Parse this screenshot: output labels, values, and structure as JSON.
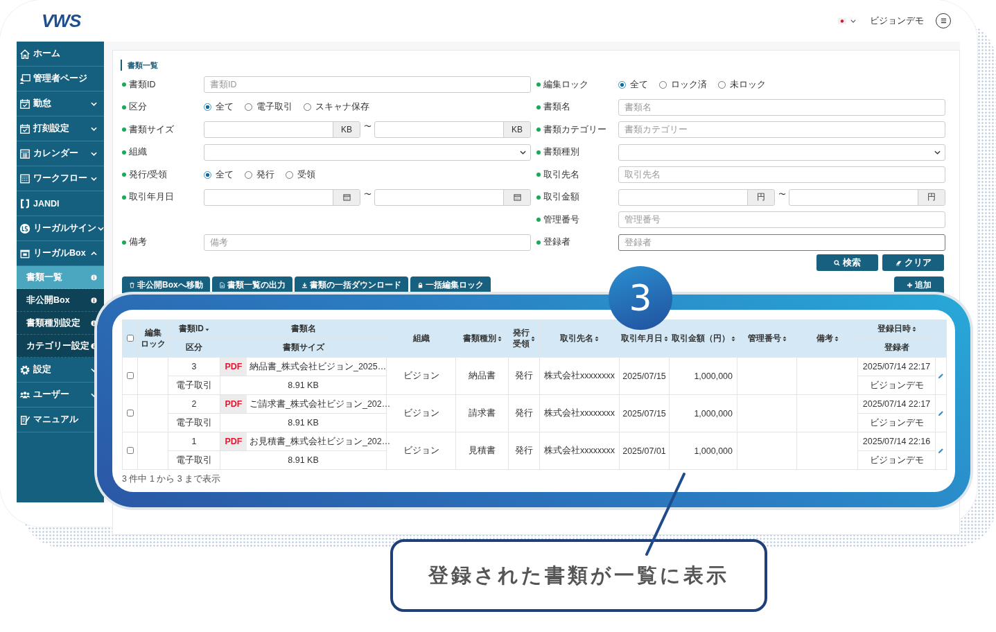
{
  "header": {
    "logo": "VWS",
    "user_name": "ビジョンデモ"
  },
  "sidebar": {
    "items": [
      {
        "label": "ホーム"
      },
      {
        "label": "管理者ページ"
      },
      {
        "label": "勤怠",
        "expanded": false
      },
      {
        "label": "打刻設定",
        "expanded": false
      },
      {
        "label": "カレンダー",
        "expanded": false
      },
      {
        "label": "ワークフロー",
        "expanded": false
      },
      {
        "label": "JANDI"
      },
      {
        "label": "リーガルサイン",
        "expanded": false
      },
      {
        "label": "リーガルBox",
        "expanded": true,
        "children": [
          {
            "label": "書類一覧",
            "selected": true
          },
          {
            "label": "非公開Box",
            "selected": false
          },
          {
            "label": "書類種別設定",
            "selected": false
          },
          {
            "label": "カテゴリー設定",
            "selected": false
          }
        ]
      },
      {
        "label": "設定",
        "expanded": false
      },
      {
        "label": "ユーザー",
        "expanded": false
      },
      {
        "label": "マニュアル"
      }
    ]
  },
  "page": {
    "title": "書類一覧"
  },
  "search_form": {
    "left": [
      {
        "label": "書類ID",
        "kind": "text",
        "placeholder": "書類ID",
        "focused": false
      },
      {
        "label": "区分",
        "kind": "radio",
        "options": [
          {
            "label": "全て",
            "selected": true
          },
          {
            "label": "電子取引",
            "selected": false
          },
          {
            "label": "スキャナ保存",
            "selected": false
          }
        ]
      },
      {
        "label": "書類サイズ",
        "kind": "range",
        "units": [
          "KB",
          "KB"
        ],
        "separator": "〜"
      },
      {
        "label": "組織",
        "kind": "select"
      },
      {
        "label": "発行/受領",
        "kind": "radio",
        "options": [
          {
            "label": "全て",
            "selected": true
          },
          {
            "label": "発行",
            "selected": false
          },
          {
            "label": "受領",
            "selected": false
          }
        ]
      },
      {
        "label": "取引年月日",
        "kind": "date_range",
        "separator": "〜"
      },
      {
        "label": "備考",
        "kind": "text",
        "placeholder": "備考",
        "focused": false
      }
    ],
    "right": [
      {
        "label": "編集ロック",
        "kind": "radio",
        "options": [
          {
            "label": "全て",
            "selected": true
          },
          {
            "label": "ロック済",
            "selected": false
          },
          {
            "label": "未ロック",
            "selected": false
          }
        ]
      },
      {
        "label": "書類名",
        "kind": "text",
        "placeholder": "書類名",
        "focused": false
      },
      {
        "label": "書類カテゴリー",
        "kind": "text",
        "placeholder": "書類カテゴリー",
        "focused": false
      },
      {
        "label": "書類種別",
        "kind": "select"
      },
      {
        "label": "取引先名",
        "kind": "text",
        "placeholder": "取引先名",
        "focused": false
      },
      {
        "label": "取引金額",
        "kind": "range",
        "units": [
          "円",
          "円"
        ],
        "separator": "〜"
      },
      {
        "label": "管理番号",
        "kind": "text",
        "placeholder": "管理番号",
        "focused": false
      },
      {
        "label": "登録者",
        "kind": "text",
        "placeholder": "登録者",
        "focused": true
      }
    ],
    "buttons": [
      {
        "label": "検索"
      },
      {
        "label": "クリア"
      }
    ]
  },
  "toolbar": {
    "actions": [
      {
        "label": "非公開Boxへ移動"
      },
      {
        "label": "書類一覧の出力"
      },
      {
        "label": "書類の一括ダウンロード"
      },
      {
        "label": "一括編集ロック"
      }
    ],
    "add_button": {
      "label": "追加"
    }
  },
  "table": {
    "select_all": false,
    "columns": [
      {
        "lines": [
          "編集",
          "ロック"
        ]
      },
      {
        "lines": [
          "書類ID"
        ],
        "sub_label": "区分"
      },
      {
        "lines": [
          "書類名"
        ],
        "sub_label": "書類サイズ"
      },
      {
        "lines": [
          "組織"
        ]
      },
      {
        "lines": [
          "書類種別"
        ]
      },
      {
        "lines": [
          "発行",
          "受領"
        ]
      },
      {
        "lines": [
          "取引先名"
        ]
      },
      {
        "lines": [
          "取引年月日"
        ]
      },
      {
        "lines": [
          "取引金額（円）"
        ]
      },
      {
        "lines": [
          "管理番号"
        ]
      },
      {
        "lines": [
          "備考"
        ]
      },
      {
        "lines": [
          "登録日時"
        ],
        "sub_label": "登録者"
      }
    ],
    "rows": [
      {
        "checked": false,
        "id": "3",
        "category": "電子取引",
        "file_type": "PDF",
        "file_name": "納品書_株式会社ビジョン_2025…",
        "file_size": "8.91 KB",
        "organization": "ビジョン",
        "document_type": "納品書",
        "issue_type": "発行",
        "partner": "株式会社xxxxxxxx",
        "transaction_date": "2025/07/15",
        "amount": "1,000,000",
        "registered_at": "2025/07/14 22:17",
        "registrant": "ビジョンデモ"
      },
      {
        "checked": false,
        "id": "2",
        "category": "電子取引",
        "file_type": "PDF",
        "file_name": "ご請求書_株式会社ビジョン_202…",
        "file_size": "8.91 KB",
        "organization": "ビジョン",
        "document_type": "請求書",
        "issue_type": "発行",
        "partner": "株式会社xxxxxxxx",
        "transaction_date": "2025/07/15",
        "amount": "1,000,000",
        "registered_at": "2025/07/14 22:17",
        "registrant": "ビジョンデモ"
      },
      {
        "checked": false,
        "id": "1",
        "category": "電子取引",
        "file_type": "PDF",
        "file_name": "お見積書_株式会社ビジョン_202…",
        "file_size": "8.91 KB",
        "organization": "ビジョン",
        "document_type": "見積書",
        "issue_type": "発行",
        "partner": "株式会社xxxxxxxx",
        "transaction_date": "2025/07/01",
        "amount": "1,000,000",
        "registered_at": "2025/07/14 22:16",
        "registrant": "ビジョンデモ"
      }
    ],
    "footer": "3 件中 1 から 3 まで表示"
  },
  "annotation": {
    "step": "3",
    "callout": "登録された書類が一覧に表示"
  }
}
